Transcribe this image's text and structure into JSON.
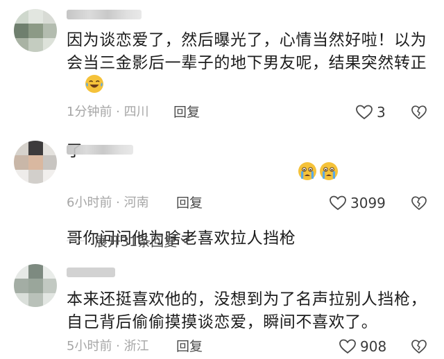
{
  "comments": [
    {
      "text": "因为谈恋爱了，然后曝光了，心情当然好啦！以为会当三金影后一辈子的地下男友呢，结果突然转正了",
      "emoji": "laughing-tears-emoji",
      "meta": "1分钟前 · 四川",
      "reply_label": "回复",
      "likes": "3"
    },
    {
      "text": "哥你问问他为啥老喜欢拉人挡枪",
      "emoji": "crying-emoji",
      "meta": "6小时前 · 河南",
      "reply_label": "回复",
      "likes": "3099"
    },
    {
      "text": "本来还挺喜欢他的，没想到为了名声拉别人挡枪，自己背后偷偷摸摸谈恋爱，瞬间不喜欢了。",
      "meta": "5小时前 · 浙江",
      "reply_label": "回复",
      "likes": "908"
    }
  ],
  "expand_replies": {
    "label": "展开31条回复"
  },
  "colors": {
    "text": "#1c1c1c",
    "meta": "#a6a6a6",
    "emoji_yellow": "#f5c23a",
    "tear_blue": "#5aa9e6"
  },
  "icons": {
    "like": "heart-outline-icon",
    "dislike": "broken-heart-icon",
    "expand": "chevron-down-icon"
  }
}
